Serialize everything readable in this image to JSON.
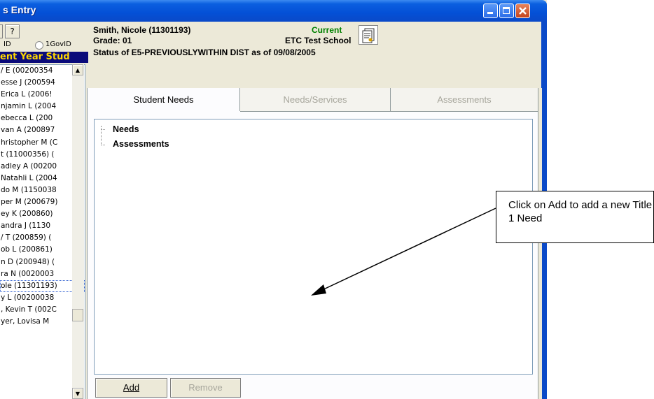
{
  "window": {
    "title": "s Entry",
    "buttons": {
      "minimize": "minimize",
      "maximize": "maximize",
      "close": "close"
    }
  },
  "left_panel": {
    "help_button": "?",
    "radio_id_label": "ID",
    "radio_govid_label": "1GovID",
    "year_header": "ent Year Stud",
    "list_items": [
      "/ E (00200354",
      "esse J (200594",
      "Erica L (2006!",
      "njamin L (2004",
      "ebecca L (200",
      "van A (200897",
      "hristopher M (C",
      "t (11000356) (",
      "adley A (00200",
      "Natahli L (2004",
      "do M (1150038",
      "per M (200679)",
      "ey K (200860)",
      "andra J (1130",
      "/ T (200859) (",
      "ob L (200861)",
      "n D (200948) (",
      "ra N (0020003",
      "ole (11301193)",
      "y L (00200038",
      ", Kevin T (002C",
      "yer, Lovisa M"
    ],
    "selected_index": 18
  },
  "student": {
    "name_id": "Smith, Nicole  (11301193)",
    "grade": "Grade: 01",
    "status": "Current",
    "school": "ETC Test School",
    "status_line": "Status of E5-PREVIOUSLYWITHIN DIST as of 09/08/2005"
  },
  "tabs": [
    {
      "label": "Student Needs",
      "active": true
    },
    {
      "label": "Needs/Services",
      "active": false
    },
    {
      "label": "Assessments",
      "active": false
    }
  ],
  "tree": {
    "nodes": [
      "Needs",
      "Assessments"
    ]
  },
  "actions": {
    "add": "Add",
    "remove": "Remove"
  },
  "callout": {
    "text": "Click on Add to add a new Title 1 Need"
  },
  "colors": {
    "titlebar": "#0450d6",
    "year_header_bg": "#0a0a7a",
    "year_header_text": "#ffd800",
    "status_current": "#008000",
    "disabled_text": "#a7a69c"
  }
}
